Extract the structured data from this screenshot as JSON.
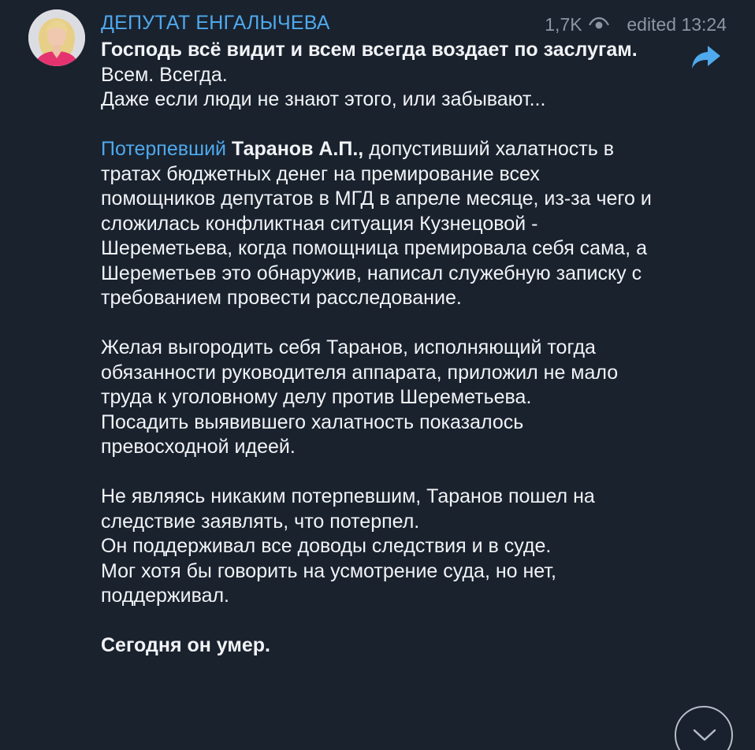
{
  "channel": {
    "name": "ДЕПУТАТ ЕНГАЛЫЧЕВА",
    "views": "1,7K",
    "edited_label": "edited",
    "time": "13:24"
  },
  "message": {
    "heading": "Господь всё видит и всем всегда воздает по заслугам.",
    "p1_line1": "Всем. Всегда.",
    "p1_line2": "Даже если люди не знают этого, или забывают...",
    "p2_link": "Потерпевший",
    "p2_bold": "Таранов А.П.,",
    "p2_rest": "допустивший халатность в тратах бюджетных денег на премирование всех помощников депутатов в МГД в апреле месяце, из-за чего и сложилась конфликтная ситуация Кузнецовой - Шереметьева, когда помощница премировала себя сама, а Шереметьев это обнаружив, написал служебную записку с требованием провести расследование.",
    "p3_text": "Желая выгородить себя Таранов, исполняющий тогда обязанности руководителя аппарата, приложил не мало труда к уголовному делу против Шереметьева.",
    "p3_line2": "Посадить выявившего халатность показалось превосходной идеей.",
    "p4_line1": "Не являясь никаким потерпевшим, Таранов пошел на следствие заявлять, что потерпел.",
    "p4_line2": "Он поддерживал все доводы следствия и в суде.",
    "p4_line3": "Мог хотя бы говорить на усмотрение суда, но нет, поддерживал.",
    "p5_bold": "Сегодня он умер."
  },
  "icons": {
    "views": "eye-icon",
    "share": "share-arrow-icon",
    "scroll": "chevron-down-icon"
  },
  "colors": {
    "background": "#1a222e",
    "accent": "#4fa9ec",
    "text": "#f1f3f6",
    "meta": "#8c96a3"
  }
}
